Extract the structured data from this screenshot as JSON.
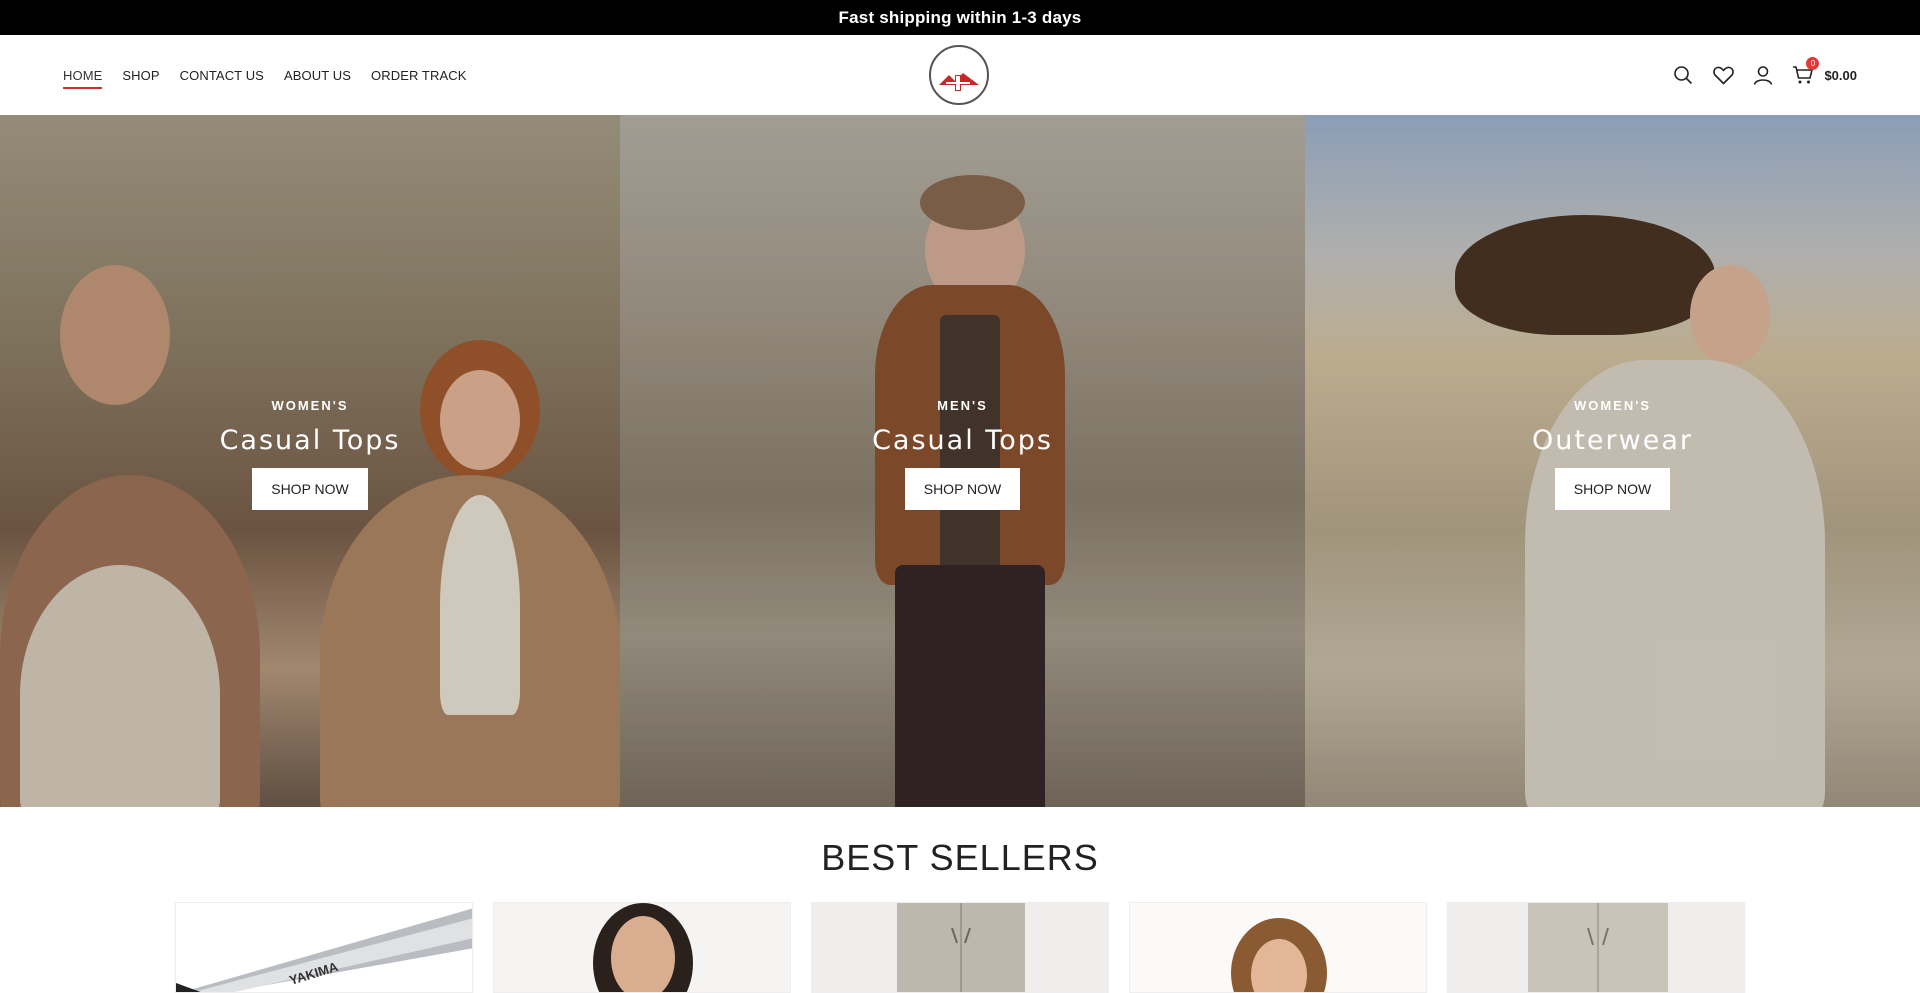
{
  "announcement": "Fast shipping within 1-3 days",
  "nav": [
    {
      "label": "HOME",
      "active": true
    },
    {
      "label": "SHOP"
    },
    {
      "label": "CONTACT US"
    },
    {
      "label": "ABOUT US"
    },
    {
      "label": "ORDER TRACK"
    }
  ],
  "header_icons": [
    "search-icon",
    "heart-icon",
    "user-icon",
    "cart-icon"
  ],
  "cart": {
    "count": "0",
    "total": "$0.00"
  },
  "hero": [
    {
      "subtitle": "WOMEN'S",
      "title": "Casual Tops",
      "button": "SHOP NOW"
    },
    {
      "subtitle": "MEN'S",
      "title": "Casual Tops",
      "button": "SHOP NOW"
    },
    {
      "subtitle": "WOMEN'S",
      "title": "Outerwear",
      "button": "SHOP NOW"
    }
  ],
  "best_sellers": {
    "heading": "BEST SELLERS"
  },
  "products": [
    {
      "name": "YAKIMA"
    },
    {},
    {},
    {},
    {}
  ],
  "colors": {
    "accent": "#d32f2f",
    "badge": "#e53935",
    "topbar": "#000000"
  }
}
